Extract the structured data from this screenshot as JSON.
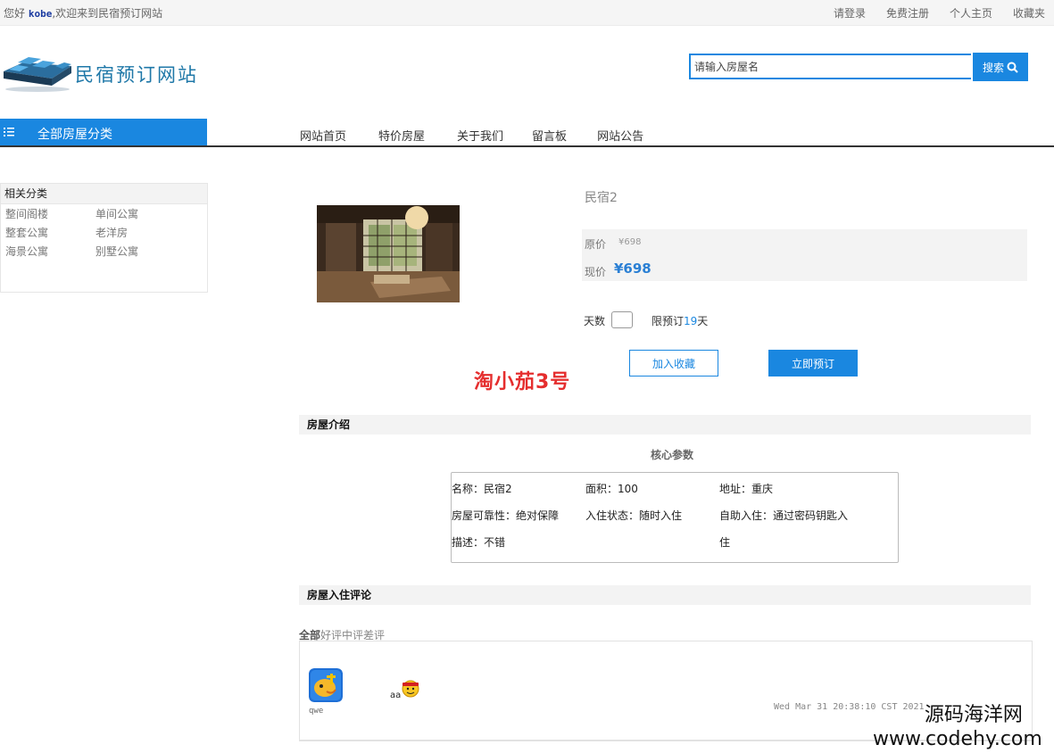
{
  "topbar": {
    "greeting_prefix": "您好",
    "username": "kobe",
    "greeting_suffix": ",欢迎来到民宿预订网站",
    "links": [
      "请登录",
      "免费注册",
      "个人主页",
      "收藏夹"
    ]
  },
  "logo": {
    "text": "民宿预订网站"
  },
  "search": {
    "placeholder": "请输入房屋名",
    "button": "搜索",
    "button_icon": "search-icon"
  },
  "nav": {
    "category_label": "全部房屋分类",
    "items": [
      "网站首页",
      "特价房屋",
      "关于我们",
      "留言板",
      "网站公告"
    ],
    "accent": "#1a87e0"
  },
  "related": {
    "title": "相关分类",
    "items": [
      "整间阁楼",
      "单间公寓",
      "整套公寓",
      "老洋房",
      "海景公寓",
      "别墅公寓"
    ]
  },
  "product": {
    "name": "民宿2",
    "orig_label": "原价",
    "orig_price": "¥698",
    "now_label": "现价",
    "now_price": "¥698",
    "days_label": "天数",
    "limit_prefix": "限预订",
    "limit_days": "19",
    "limit_suffix": "天",
    "fav_button": "加入收藏",
    "book_button": "立即预订",
    "price_color": "#2a7fd4"
  },
  "overlay_text": "淘小茄3号",
  "intro": {
    "title": "房屋介绍",
    "core_title": "核心参数",
    "params": {
      "name": "名称：民宿2",
      "area": "面积：100",
      "address": "地址：重庆",
      "reliability": "房屋可靠性：绝对保障",
      "status": "入住状态：随时入住",
      "self_checkin_1": "自助入住：通过密码钥匙入",
      "self_checkin_2": "住",
      "desc": "描述：不错"
    }
  },
  "reviews": {
    "title": "房屋入住评论",
    "filters": [
      "全部",
      "好评",
      "中评",
      "差评"
    ],
    "comment": {
      "user": "qwe",
      "text": "aa",
      "emoji_icon": "smiley-emoji-icon",
      "date": "Wed Mar 31 20:38:10 CST 2021"
    }
  },
  "watermark": {
    "cn": "源码海洋网",
    "en": "www.codehy.com"
  }
}
